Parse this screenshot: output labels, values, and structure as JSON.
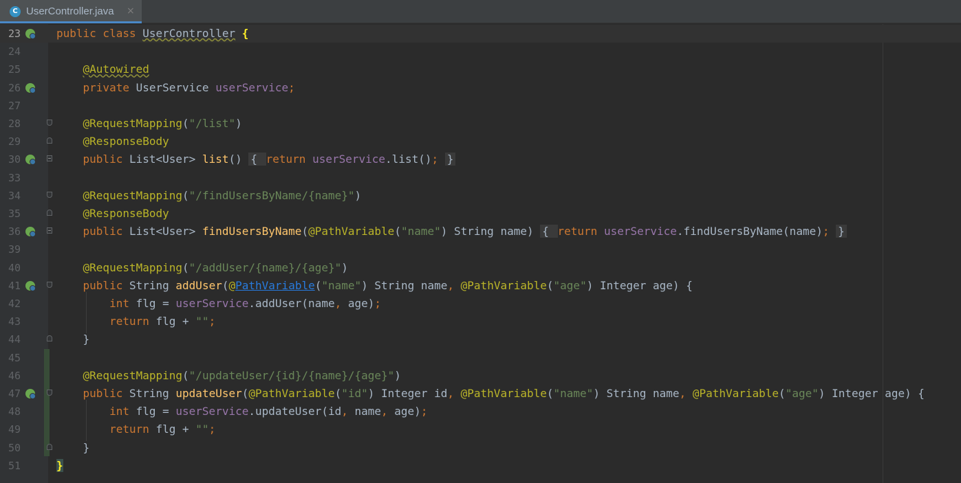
{
  "tab": {
    "icon": "java-class-icon",
    "icon_letter": "C",
    "label": "UserController.java",
    "close": "×"
  },
  "lines": [
    {
      "num": "23",
      "gutter": "spring-bean-icon",
      "fold": "",
      "tokens": [
        [
          "kw",
          "public class "
        ],
        [
          "cls",
          "UserController"
        ],
        [
          "plain",
          " "
        ],
        [
          "brace",
          "{"
        ]
      ]
    },
    {
      "num": "24",
      "gutter": "",
      "fold": "",
      "tokens": []
    },
    {
      "num": "25",
      "gutter": "",
      "fold": "",
      "tokens": [
        [
          "plain",
          "    "
        ],
        [
          "annw",
          "@Autowired"
        ]
      ]
    },
    {
      "num": "26",
      "gutter": "spring-autowire-icon",
      "fold": "",
      "tokens": [
        [
          "plain",
          "    "
        ],
        [
          "kw",
          "private "
        ],
        [
          "plain",
          "UserService "
        ],
        [
          "fld",
          "userService"
        ],
        [
          "punc",
          ";"
        ]
      ]
    },
    {
      "num": "27",
      "gutter": "",
      "fold": "",
      "tokens": []
    },
    {
      "num": "28",
      "gutter": "",
      "fold": "start",
      "tokens": [
        [
          "plain",
          "    "
        ],
        [
          "ann",
          "@RequestMapping"
        ],
        [
          "plain",
          "("
        ],
        [
          "str",
          "\"/list\""
        ],
        [
          "plain",
          ")"
        ]
      ]
    },
    {
      "num": "29",
      "gutter": "",
      "fold": "end",
      "tokens": [
        [
          "plain",
          "    "
        ],
        [
          "ann",
          "@ResponseBody"
        ]
      ]
    },
    {
      "num": "30",
      "gutter": "spring-mapping-icon",
      "fold": "plus",
      "tokens": [
        [
          "plain",
          "    "
        ],
        [
          "kw",
          "public "
        ],
        [
          "plain",
          "List<User> "
        ],
        [
          "fn",
          "list"
        ],
        [
          "plain",
          "() "
        ],
        [
          "chip",
          "{ "
        ],
        [
          "kw",
          "return "
        ],
        [
          "fld",
          "userService"
        ],
        [
          "plain",
          ".list()"
        ],
        [
          "punc",
          ";"
        ],
        [
          "plain",
          " "
        ],
        [
          "chip",
          "}"
        ]
      ]
    },
    {
      "num": "33",
      "gutter": "",
      "fold": "",
      "tokens": []
    },
    {
      "num": "34",
      "gutter": "",
      "fold": "start",
      "tokens": [
        [
          "plain",
          "    "
        ],
        [
          "ann",
          "@RequestMapping"
        ],
        [
          "plain",
          "("
        ],
        [
          "str",
          "\"/findUsersByName/{name}\""
        ],
        [
          "plain",
          ")"
        ]
      ]
    },
    {
      "num": "35",
      "gutter": "",
      "fold": "end",
      "tokens": [
        [
          "plain",
          "    "
        ],
        [
          "ann",
          "@ResponseBody"
        ]
      ]
    },
    {
      "num": "36",
      "gutter": "spring-mapping-icon",
      "fold": "plus",
      "tokens": [
        [
          "plain",
          "    "
        ],
        [
          "kw",
          "public "
        ],
        [
          "plain",
          "List<User> "
        ],
        [
          "fn",
          "findUsersByName"
        ],
        [
          "plain",
          "("
        ],
        [
          "ann",
          "@PathVariable"
        ],
        [
          "plain",
          "("
        ],
        [
          "str",
          "\"name\""
        ],
        [
          "plain",
          ") String name) "
        ],
        [
          "chip",
          "{ "
        ],
        [
          "kw",
          "return "
        ],
        [
          "fld",
          "userService"
        ],
        [
          "plain",
          ".findUsersByName(name)"
        ],
        [
          "punc",
          ";"
        ],
        [
          "plain",
          " "
        ],
        [
          "chip",
          "}"
        ]
      ]
    },
    {
      "num": "39",
      "gutter": "",
      "fold": "",
      "tokens": []
    },
    {
      "num": "40",
      "gutter": "",
      "fold": "",
      "tokens": [
        [
          "plain",
          "    "
        ],
        [
          "ann",
          "@RequestMapping"
        ],
        [
          "plain",
          "("
        ],
        [
          "str",
          "\"/addUser/{name}/{age}\""
        ],
        [
          "plain",
          ")"
        ]
      ]
    },
    {
      "num": "41",
      "gutter": "spring-mapping-icon",
      "fold": "start",
      "tokens": [
        [
          "plain",
          "    "
        ],
        [
          "kw",
          "public "
        ],
        [
          "plain",
          "String "
        ],
        [
          "fn",
          "addUser"
        ],
        [
          "plain",
          "("
        ],
        [
          "ann",
          "@"
        ],
        [
          "link",
          "PathVariable"
        ],
        [
          "plain",
          "("
        ],
        [
          "str",
          "\"name\""
        ],
        [
          "plain",
          ") String name"
        ],
        [
          "punc",
          ", "
        ],
        [
          "ann",
          "@PathVariable"
        ],
        [
          "plain",
          "("
        ],
        [
          "str",
          "\"age\""
        ],
        [
          "plain",
          ") Integer age) {"
        ]
      ]
    },
    {
      "num": "42",
      "gutter": "",
      "fold": "",
      "tokens": [
        [
          "plain",
          "        "
        ],
        [
          "kw",
          "int "
        ],
        [
          "plain",
          "flg = "
        ],
        [
          "fld",
          "userService"
        ],
        [
          "plain",
          ".addUser(name"
        ],
        [
          "punc",
          ", "
        ],
        [
          "plain",
          "age)"
        ],
        [
          "punc",
          ";"
        ]
      ]
    },
    {
      "num": "43",
      "gutter": "",
      "fold": "",
      "tokens": [
        [
          "plain",
          "        "
        ],
        [
          "kw",
          "return "
        ],
        [
          "plain",
          "flg + "
        ],
        [
          "str",
          "\"\""
        ],
        [
          "punc",
          ";"
        ]
      ]
    },
    {
      "num": "44",
      "gutter": "",
      "fold": "end",
      "tokens": [
        [
          "plain",
          "    }"
        ]
      ]
    },
    {
      "num": "45",
      "gutter": "",
      "fold": "",
      "tokens": []
    },
    {
      "num": "46",
      "gutter": "",
      "fold": "",
      "tokens": [
        [
          "plain",
          "    "
        ],
        [
          "ann",
          "@RequestMapping"
        ],
        [
          "plain",
          "("
        ],
        [
          "str",
          "\"/updateUser/{id}/{name}/{age}\""
        ],
        [
          "plain",
          ")"
        ]
      ]
    },
    {
      "num": "47",
      "gutter": "spring-mapping-icon",
      "fold": "start",
      "tokens": [
        [
          "plain",
          "    "
        ],
        [
          "kw",
          "public "
        ],
        [
          "plain",
          "String "
        ],
        [
          "fn",
          "updateUser"
        ],
        [
          "plain",
          "("
        ],
        [
          "ann",
          "@PathVariable"
        ],
        [
          "plain",
          "("
        ],
        [
          "str",
          "\"id\""
        ],
        [
          "plain",
          ") Integer id"
        ],
        [
          "punc",
          ", "
        ],
        [
          "ann",
          "@PathVariable"
        ],
        [
          "plain",
          "("
        ],
        [
          "str",
          "\"name\""
        ],
        [
          "plain",
          ") String name"
        ],
        [
          "punc",
          ", "
        ],
        [
          "ann",
          "@PathVariable"
        ],
        [
          "plain",
          "("
        ],
        [
          "str",
          "\"age\""
        ],
        [
          "plain",
          ") Integer age) {"
        ]
      ]
    },
    {
      "num": "48",
      "gutter": "",
      "fold": "",
      "tokens": [
        [
          "plain",
          "        "
        ],
        [
          "kw",
          "int "
        ],
        [
          "plain",
          "flg = "
        ],
        [
          "fld",
          "userService"
        ],
        [
          "plain",
          ".updateUser(id"
        ],
        [
          "punc",
          ", "
        ],
        [
          "plain",
          "name"
        ],
        [
          "punc",
          ", "
        ],
        [
          "plain",
          "age)"
        ],
        [
          "punc",
          ";"
        ]
      ]
    },
    {
      "num": "49",
      "gutter": "",
      "fold": "",
      "tokens": [
        [
          "plain",
          "        "
        ],
        [
          "kw",
          "return "
        ],
        [
          "plain",
          "flg + "
        ],
        [
          "str",
          "\"\""
        ],
        [
          "punc",
          ";"
        ]
      ]
    },
    {
      "num": "50",
      "gutter": "",
      "fold": "end",
      "tokens": [
        [
          "plain",
          "    }"
        ]
      ]
    },
    {
      "num": "51",
      "gutter": "",
      "fold": "",
      "tokens": [
        [
          "bracebox",
          "}"
        ]
      ]
    }
  ],
  "colors": {
    "background": "#2b2b2b",
    "gutter": "#313335",
    "keyword": "#cc7832",
    "annotation": "#bbb529",
    "string": "#6a8759",
    "field": "#9876aa",
    "method": "#ffc66d",
    "text": "#a9b7c6",
    "line_number": "#606366"
  }
}
